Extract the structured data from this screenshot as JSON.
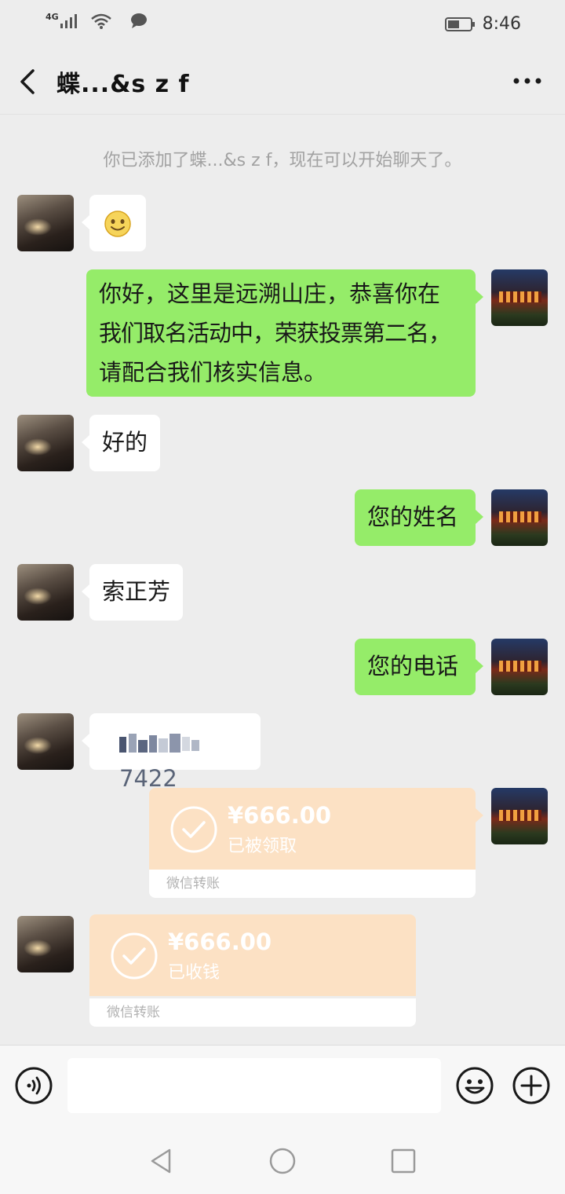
{
  "status_bar": {
    "network": "4G",
    "time": "8:46"
  },
  "header": {
    "title": "蝶...&s z f"
  },
  "system_message": "你已添加了蝶...&s z f，现在可以开始聊天了。",
  "messages": [
    {
      "direction": "in",
      "text": "",
      "emoji": "smile-emoji"
    },
    {
      "direction": "out",
      "text_lines": [
        "你好，这里是远溯山庄，恭喜你在",
        "我们取名活动中，荣获投票第二名，",
        "请配合我们核实信息。"
      ]
    },
    {
      "direction": "in",
      "text": "好的"
    },
    {
      "direction": "out",
      "text": "您的姓名"
    },
    {
      "direction": "in",
      "text": "索正芳"
    },
    {
      "direction": "out",
      "text": "您的电话"
    },
    {
      "direction": "in",
      "text": "7422"
    }
  ],
  "transfers": [
    {
      "direction": "out",
      "amount": "¥666.00",
      "status": "已被领取",
      "label": "微信转账"
    },
    {
      "direction": "in",
      "amount": "¥666.00",
      "status": "已收钱",
      "label": "微信转账"
    }
  ],
  "colors": {
    "background": "#ededed",
    "bubble_out": "#95ec69",
    "bubble_in": "#ffffff",
    "transfer_bg": "#fce1c4"
  }
}
